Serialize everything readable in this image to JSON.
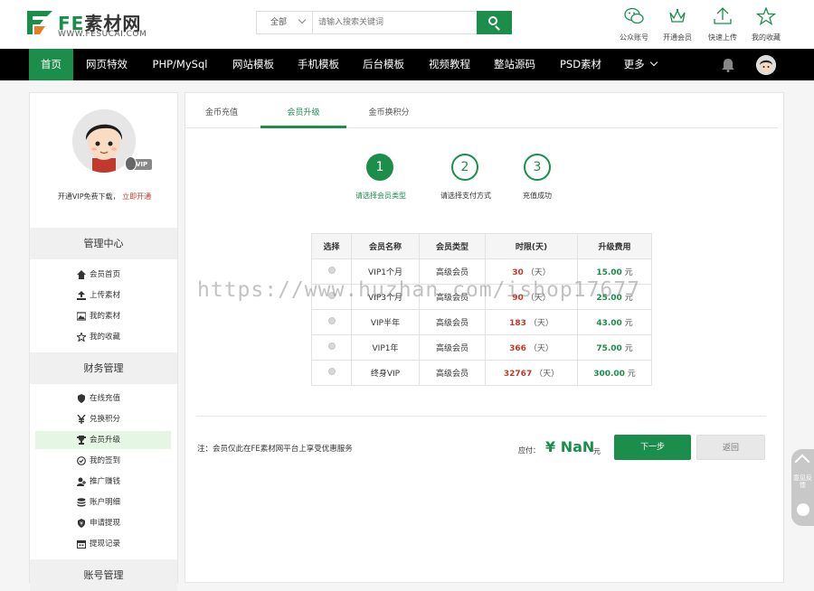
{
  "brand": {
    "logo_text_fe": "FE",
    "logo_text_rest": "素材网",
    "logo_sub": "WWW.FESUCAI.COM",
    "accent": "#1a8e4a"
  },
  "search": {
    "category": "全部",
    "placeholder": "请输入搜索关键词"
  },
  "toplinks": [
    {
      "label": "公众账号",
      "icon": "wechat-icon"
    },
    {
      "label": "开通会员",
      "icon": "crown-icon"
    },
    {
      "label": "快速上传",
      "icon": "upload-icon"
    },
    {
      "label": "我的收藏",
      "icon": "star-icon"
    }
  ],
  "nav": {
    "items": [
      "首页",
      "网页特效",
      "PHP/MySql",
      "网站模板",
      "手机模板",
      "后台模板",
      "视频教程",
      "整站源码",
      "PSD素材"
    ],
    "more": "更多"
  },
  "sidebar": {
    "vip_badge": "VIP",
    "vip_note": "开通VIP免费下载，",
    "vip_link": "立即开通",
    "sections": [
      {
        "title": "管理中心",
        "items": [
          "会员首页",
          "上传素材",
          "我的素材",
          "我的收藏"
        ]
      },
      {
        "title": "财务管理",
        "items": [
          "在线充值",
          "兑换积分",
          "会员升级",
          "我的签到",
          "推广赚钱",
          "账户明细",
          "申请提现",
          "提现记录"
        ]
      },
      {
        "title": "账号管理",
        "items": []
      }
    ]
  },
  "tabs": [
    "金币充值",
    "会员升级",
    "金币换积分"
  ],
  "steps": [
    {
      "num": "1",
      "label": "请选择会员类型"
    },
    {
      "num": "2",
      "label": "请选择支付方式"
    },
    {
      "num": "3",
      "label": "充值成功"
    }
  ],
  "plans": {
    "headers": [
      "选择",
      "会员名称",
      "会员类型",
      "时限(天)",
      "升级费用"
    ],
    "day_unit": "（天）",
    "price_unit": "元",
    "rows": [
      {
        "name": "VIP1个月",
        "type": "高级会员",
        "days": "30",
        "price": "15.00"
      },
      {
        "name": "VIP3个月",
        "type": "高级会员",
        "days": "90",
        "price": "25.00"
      },
      {
        "name": "VIP半年",
        "type": "高级会员",
        "days": "183",
        "price": "43.00"
      },
      {
        "name": "VIP1年",
        "type": "高级会员",
        "days": "366",
        "price": "75.00"
      },
      {
        "name": "终身VIP",
        "type": "高级会员",
        "days": "32767",
        "price": "300.00"
      }
    ]
  },
  "footer": {
    "note": "注：会员仅此在FE素材网平台上享受优惠服务",
    "pay_label": "应付：",
    "pay_amount": "¥ NaN",
    "pay_unit": "元",
    "next": "下一步",
    "back": "返回"
  },
  "float_tool": {
    "text": "意见反馈"
  },
  "watermark": "https://www.huzhan.com/ishop17677"
}
